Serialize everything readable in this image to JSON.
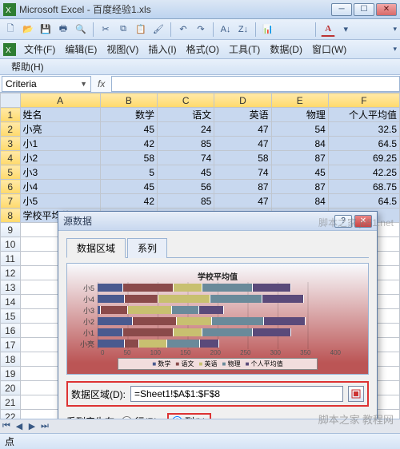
{
  "window": {
    "app": "Microsoft Excel",
    "doc": "百度经验1.xls"
  },
  "menu": {
    "file": "文件(F)",
    "edit": "编辑(E)",
    "view": "视图(V)",
    "insert": "插入(I)",
    "format": "格式(O)",
    "tools": "工具(T)",
    "data": "数据(D)",
    "window": "窗口(W)",
    "help": "帮助(H)"
  },
  "namebox": "Criteria",
  "formula": "",
  "fx_label": "fx",
  "columns": [
    "A",
    "B",
    "C",
    "D",
    "E",
    "F"
  ],
  "headers": {
    "A": "姓名",
    "B": "数学",
    "C": "语文",
    "D": "英语",
    "E": "物理",
    "F": "个人平均值"
  },
  "rows": [
    {
      "A": "小亮",
      "B": 45,
      "C": 24,
      "D": 47,
      "E": 54,
      "F": "32.5"
    },
    {
      "A": "小1",
      "B": 42,
      "C": 85,
      "D": 47,
      "E": 84,
      "F": "64.5"
    },
    {
      "A": "小2",
      "B": 58,
      "C": 74,
      "D": 58,
      "E": 87,
      "F": "69.25"
    },
    {
      "A": "小3",
      "B": 5,
      "C": 45,
      "D": 74,
      "E": 45,
      "F": "42.25"
    },
    {
      "A": "小4",
      "B": 45,
      "C": 56,
      "D": 87,
      "E": 87,
      "F": "68.75"
    },
    {
      "A": "小5",
      "B": 42,
      "C": 85,
      "D": 47,
      "E": 84,
      "F": "64.5"
    },
    {
      "A": "学校平均值",
      "B": "",
      "C": "",
      "D": "",
      "E": "",
      "F": ""
    }
  ],
  "row_numbers": [
    1,
    2,
    3,
    4,
    5,
    6,
    7,
    8,
    9,
    10,
    11,
    12,
    13,
    14,
    15,
    16,
    17,
    18,
    19,
    20,
    21,
    22
  ],
  "dialog": {
    "title": "源数据",
    "tab1": "数据区域",
    "tab2": "系列",
    "chart_title": "学校平均值",
    "range_label": "数据区域(D):",
    "range_value": "=Sheet1!$A$1:$F$8",
    "series_in": "系列产生在:",
    "opt_row": "行(R)",
    "opt_col": "列(L)",
    "legend": [
      "数学",
      "语文",
      "英语",
      "物理",
      "个人平均值"
    ],
    "axis": [
      0,
      50,
      100,
      150,
      200,
      250,
      300,
      350,
      400
    ]
  },
  "chart_data": {
    "type": "bar",
    "orientation": "horizontal_stacked",
    "title": "学校平均值",
    "categories": [
      "小亮",
      "小1",
      "小2",
      "小3",
      "小4",
      "小5"
    ],
    "series": [
      {
        "name": "数学",
        "values": [
          45,
          42,
          58,
          5,
          45,
          42
        ],
        "color": "#4a5a8f"
      },
      {
        "name": "语文",
        "values": [
          24,
          85,
          74,
          45,
          56,
          85
        ],
        "color": "#8a4a4a"
      },
      {
        "name": "英语",
        "values": [
          47,
          47,
          58,
          74,
          87,
          47
        ],
        "color": "#c8c070"
      },
      {
        "name": "物理",
        "values": [
          54,
          84,
          87,
          45,
          87,
          84
        ],
        "color": "#6a8a9a"
      },
      {
        "name": "个人平均值",
        "values": [
          32.5,
          64.5,
          69.25,
          42.25,
          68.75,
          64.5
        ],
        "color": "#5a4a7a"
      }
    ],
    "xlabel": "",
    "ylabel": "",
    "xlim": [
      0,
      400
    ]
  },
  "status": "点",
  "watermark1": "脚本之家 教程网",
  "watermark2": "脚本之家 jb51.net"
}
